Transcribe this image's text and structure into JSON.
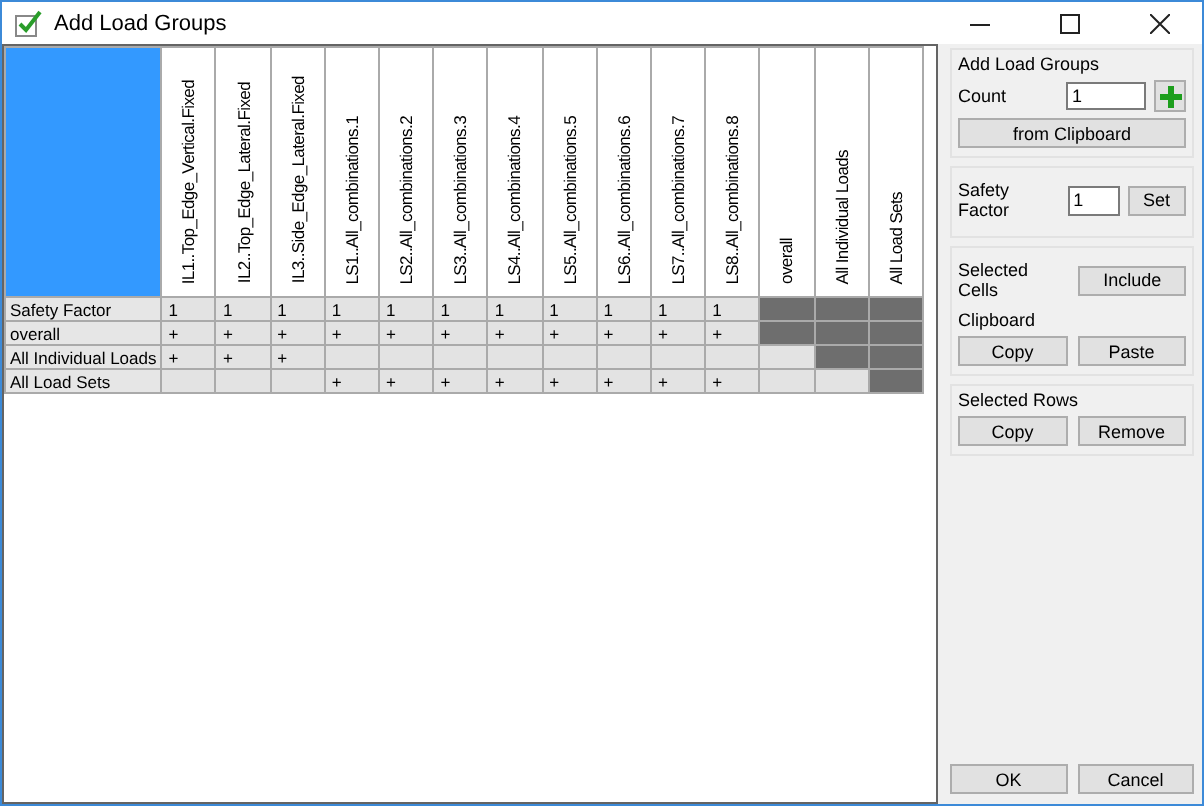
{
  "window": {
    "title": "Add Load Groups"
  },
  "grid": {
    "columns": [
      "IL1..Top_Edge_Vertical.Fixed",
      "IL2..Top_Edge_Lateral.Fixed",
      "IL3..Side_Edge_Lateral.Fixed",
      "LS1..All_combinations.1",
      "LS2..All_combinations.2",
      "LS3..All_combinations.3",
      "LS4..All_combinations.4",
      "LS5..All_combinations.5",
      "LS6..All_combinations.6",
      "LS7..All_combinations.7",
      "LS8..All_combinations.8",
      "overall",
      "All Individual Loads",
      "All Load Sets"
    ],
    "rows": [
      {
        "label": "Safety Factor",
        "cells": [
          {
            "text": "1",
            "blocked": false
          },
          {
            "text": "1",
            "blocked": false
          },
          {
            "text": "1",
            "blocked": false
          },
          {
            "text": "1",
            "blocked": false
          },
          {
            "text": "1",
            "blocked": false
          },
          {
            "text": "1",
            "blocked": false
          },
          {
            "text": "1",
            "blocked": false
          },
          {
            "text": "1",
            "blocked": false
          },
          {
            "text": "1",
            "blocked": false
          },
          {
            "text": "1",
            "blocked": false
          },
          {
            "text": "1",
            "blocked": false
          },
          {
            "blocked": true
          },
          {
            "blocked": true
          },
          {
            "blocked": true
          }
        ]
      },
      {
        "label": "overall",
        "cells": [
          {
            "text": "+",
            "blocked": false
          },
          {
            "text": "+",
            "blocked": false
          },
          {
            "text": "+",
            "blocked": false
          },
          {
            "text": "+",
            "blocked": false
          },
          {
            "text": "+",
            "blocked": false
          },
          {
            "text": "+",
            "blocked": false
          },
          {
            "text": "+",
            "blocked": false
          },
          {
            "text": "+",
            "blocked": false
          },
          {
            "text": "+",
            "blocked": false
          },
          {
            "text": "+",
            "blocked": false
          },
          {
            "text": "+",
            "blocked": false
          },
          {
            "blocked": true
          },
          {
            "blocked": true
          },
          {
            "blocked": true
          }
        ]
      },
      {
        "label": "All Individual Loads",
        "cells": [
          {
            "text": "+",
            "blocked": false
          },
          {
            "text": "+",
            "blocked": false
          },
          {
            "text": "+",
            "blocked": false
          },
          {
            "blocked": false
          },
          {
            "blocked": false
          },
          {
            "blocked": false
          },
          {
            "blocked": false
          },
          {
            "blocked": false
          },
          {
            "blocked": false
          },
          {
            "blocked": false
          },
          {
            "blocked": false
          },
          {
            "blocked": false
          },
          {
            "blocked": true
          },
          {
            "blocked": true
          }
        ]
      },
      {
        "label": "All Load Sets",
        "cells": [
          {
            "blocked": false
          },
          {
            "blocked": false
          },
          {
            "blocked": false
          },
          {
            "text": "+",
            "blocked": false
          },
          {
            "text": "+",
            "blocked": false
          },
          {
            "text": "+",
            "blocked": false
          },
          {
            "text": "+",
            "blocked": false
          },
          {
            "text": "+",
            "blocked": false
          },
          {
            "text": "+",
            "blocked": false
          },
          {
            "text": "+",
            "blocked": false
          },
          {
            "text": "+",
            "blocked": false
          },
          {
            "blocked": false
          },
          {
            "blocked": false
          },
          {
            "blocked": true
          }
        ]
      }
    ]
  },
  "add_load_groups": {
    "title": "Add Load Groups",
    "count_label": "Count",
    "count_value": "1",
    "clipboard_button": "from Clipboard"
  },
  "safety_factor": {
    "label": "Safety Factor",
    "value": "1",
    "button": "Set"
  },
  "selected_cells": {
    "label": "Selected Cells",
    "button": "Include"
  },
  "clipboard": {
    "title": "Clipboard",
    "buttons": [
      "Copy",
      "Paste"
    ]
  },
  "selected_rows": {
    "title": "Selected Rows",
    "buttons": [
      "Copy",
      "Remove"
    ]
  },
  "footer_buttons": [
    "OK",
    "Cancel"
  ]
}
